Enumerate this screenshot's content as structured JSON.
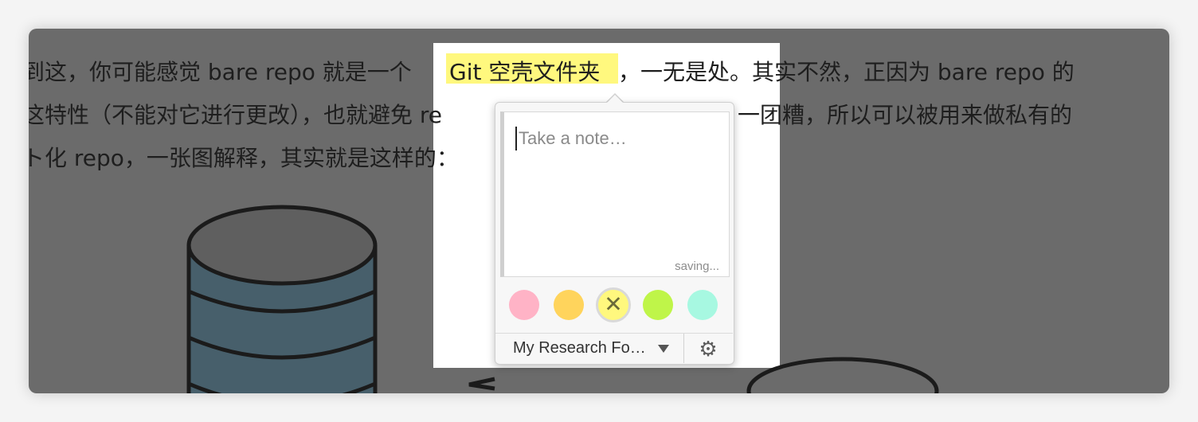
{
  "article": {
    "line1": {
      "before": "到这，你可能感觉 bare repo 就是一个 ",
      "highlight": "Git 空壳文件夹",
      "after": "，一无是处。其实不然，正因为 bare repo 的"
    },
    "line2": {
      "left": "这特性（不能对它进行更改），也就避免 re",
      "right": "一团糟，所以可以被用来做私有的"
    },
    "line3": {
      "text": "ト化 repo，一张图解释，其实就是这样的："
    }
  },
  "note_popover": {
    "placeholder": "Take a note…",
    "status": "saving...",
    "colors": [
      {
        "name": "pink",
        "hex": "#ffb3c6"
      },
      {
        "name": "orange",
        "hex": "#ffd45c"
      },
      {
        "name": "yellow",
        "hex": "#fff87e",
        "selected": true,
        "icon": "close-icon"
      },
      {
        "name": "green",
        "hex": "#bff549"
      },
      {
        "name": "teal",
        "hex": "#a7f8e1"
      }
    ],
    "folder": "My Research Fo…",
    "folder_icon": "chevron-down-icon",
    "settings_icon": "gear-icon"
  },
  "theme": {
    "overlay": "#6b6b6b",
    "highlight": "#fff87e"
  }
}
